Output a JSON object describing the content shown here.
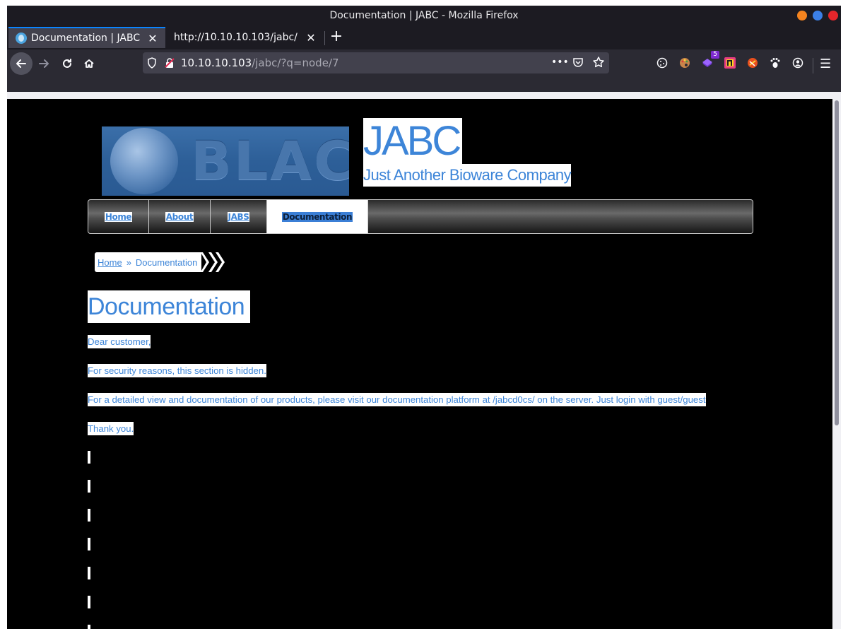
{
  "window": {
    "title": "Documentation | JABC - Mozilla Firefox",
    "controls": [
      {
        "name": "minimize",
        "color": "#f5841f"
      },
      {
        "name": "maximize",
        "color": "#3b7fe6"
      },
      {
        "name": "close",
        "color": "#e5262b"
      }
    ]
  },
  "tabs": [
    {
      "title": "Documentation | JABC",
      "active": true
    },
    {
      "title": "http://10.10.10.103/jabc/",
      "active": false
    }
  ],
  "url": {
    "host": "10.10.10.103",
    "path": "/jabc/?q=node/7"
  },
  "icons": {
    "back": "back-arrow-icon",
    "forward": "forward-arrow-icon",
    "reload": "reload-icon",
    "home": "home-icon",
    "page_actions": "more-icon",
    "pocket": "pocket-icon",
    "bookmark": "star-icon",
    "extension_badge": "5"
  },
  "site": {
    "logo_text": "BLACK",
    "name": "JABC",
    "slogan": "Just Another Bioware Company"
  },
  "menu": [
    {
      "label": "Home",
      "active": false
    },
    {
      "label": "About",
      "active": false
    },
    {
      "label": "JABS",
      "active": false
    },
    {
      "label": "Documentation",
      "active": true
    }
  ],
  "breadcrumb": {
    "home": "Home",
    "separator": "»",
    "current": "Documentation"
  },
  "page": {
    "title": "Documentation",
    "paragraphs": [
      "Dear customer,",
      "For security reasons, this section is hidden.",
      "For a detailed view and documentation of our products, please visit our documentation platform at /jabcd0cs/ on the server. Just login with guest/guest",
      "Thank you."
    ]
  },
  "colors": {
    "link": "#3d85d8",
    "page_bg": "#000000",
    "browser_chrome": "#1c1b22"
  }
}
